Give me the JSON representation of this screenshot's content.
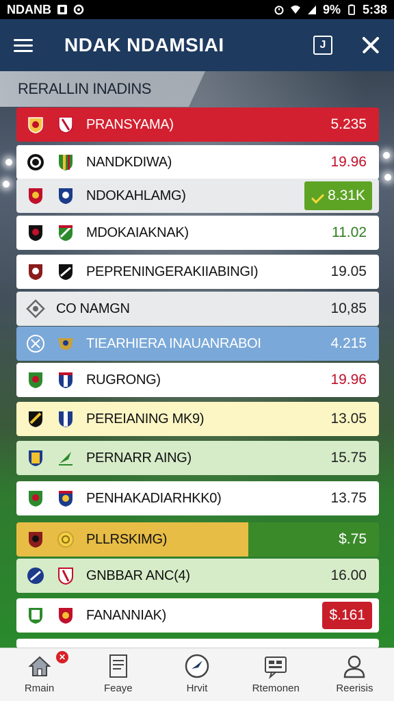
{
  "status_bar": {
    "carrier": "NDANB",
    "battery": "9%",
    "time": "5:38"
  },
  "app_bar": {
    "title": "NDAK NDAMSIAI",
    "box_icon_label": "J"
  },
  "section": {
    "title": "RERALLIN INADINS"
  },
  "rows": [
    {
      "name": "PRANSYAMA)",
      "value": "5.235"
    },
    {
      "name": "NANDKDIWA)",
      "value": "19.96"
    },
    {
      "name": "NDOKAHLAMG)",
      "value": "8.31K"
    },
    {
      "name": "MDOKAIAKNAK)",
      "value": "11.02"
    },
    {
      "name": "PEPRENINGERAKIIABINGI)",
      "value": "19.05"
    },
    {
      "name": "CO  NAMGN",
      "value": "10,85"
    },
    {
      "name": "TIEARHIERA INAUANRABOI",
      "value": "4.215"
    },
    {
      "name": "RUGRONG)",
      "value": "19.96"
    },
    {
      "name": "PEREIANING MK9)",
      "value": "13.05"
    },
    {
      "name": "PERNARR AING)",
      "value": "15.75"
    },
    {
      "name": "PENHAKADIARHKK0)",
      "value": "13.75"
    },
    {
      "name": "PLLRSKIMG)",
      "value": "$.75"
    },
    {
      "name": "GNBBAR ANC(4)",
      "value": "16.00"
    },
    {
      "name": "FANANNIAK)",
      "value": "$.161"
    }
  ],
  "bottom_nav": [
    {
      "label": "Rmain",
      "icon": "home-icon"
    },
    {
      "label": "Feaye",
      "icon": "document-icon"
    },
    {
      "label": "Hrvit",
      "icon": "compass-icon"
    },
    {
      "label": "Rtemonen",
      "icon": "chat-icon"
    },
    {
      "label": "Reerisis",
      "icon": "profile-icon"
    }
  ],
  "colors": {
    "app_bar": "#1e3a5f",
    "highlight_red": "#d32030",
    "badge_green": "#5da425",
    "row_blue": "#7aa8d8"
  }
}
